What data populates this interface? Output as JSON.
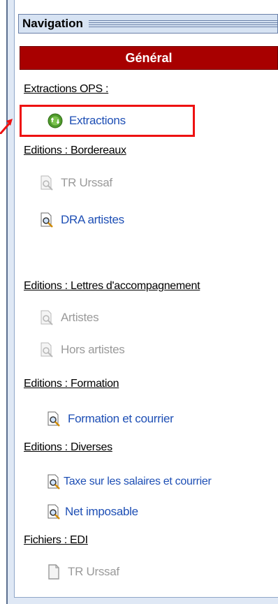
{
  "panel": {
    "title": "Navigation",
    "section": "Général"
  },
  "groups": [
    {
      "label": "Extractions OPS :",
      "items": [
        {
          "label": "Extractions",
          "icon": "refresh-icon",
          "enabled": true
        }
      ]
    },
    {
      "label": "Editions : Bordereaux",
      "items": [
        {
          "label": "TR Urssaf",
          "icon": "document-magnifier-icon",
          "enabled": false
        },
        {
          "label": "DRA artistes",
          "icon": "document-magnifier-icon",
          "enabled": true
        }
      ]
    },
    {
      "label": "Editions : Lettres d'accompagnement",
      "items": [
        {
          "label": "Artistes",
          "icon": "document-magnifier-icon",
          "enabled": false
        },
        {
          "label": "Hors artistes",
          "icon": "document-magnifier-icon",
          "enabled": false
        }
      ]
    },
    {
      "label": "Editions : Formation",
      "items": [
        {
          "label": "Formation et courrier",
          "icon": "document-magnifier-icon",
          "enabled": true
        }
      ]
    },
    {
      "label": "Editions : Diverses",
      "items": [
        {
          "label": "Taxe sur les salaires et courrier",
          "icon": "document-magnifier-icon",
          "enabled": true
        },
        {
          "label": "Net imposable",
          "icon": "document-magnifier-icon",
          "enabled": true
        }
      ]
    },
    {
      "label": "Fichiers : EDI",
      "items": [
        {
          "label": "TR Urssaf",
          "icon": "document-icon",
          "enabled": false
        }
      ]
    }
  ],
  "colors": {
    "section_bar": "#a80000",
    "link_enabled": "#1e4fb5",
    "link_disabled": "#9a9a9a",
    "highlight_box": "#ee1111"
  }
}
